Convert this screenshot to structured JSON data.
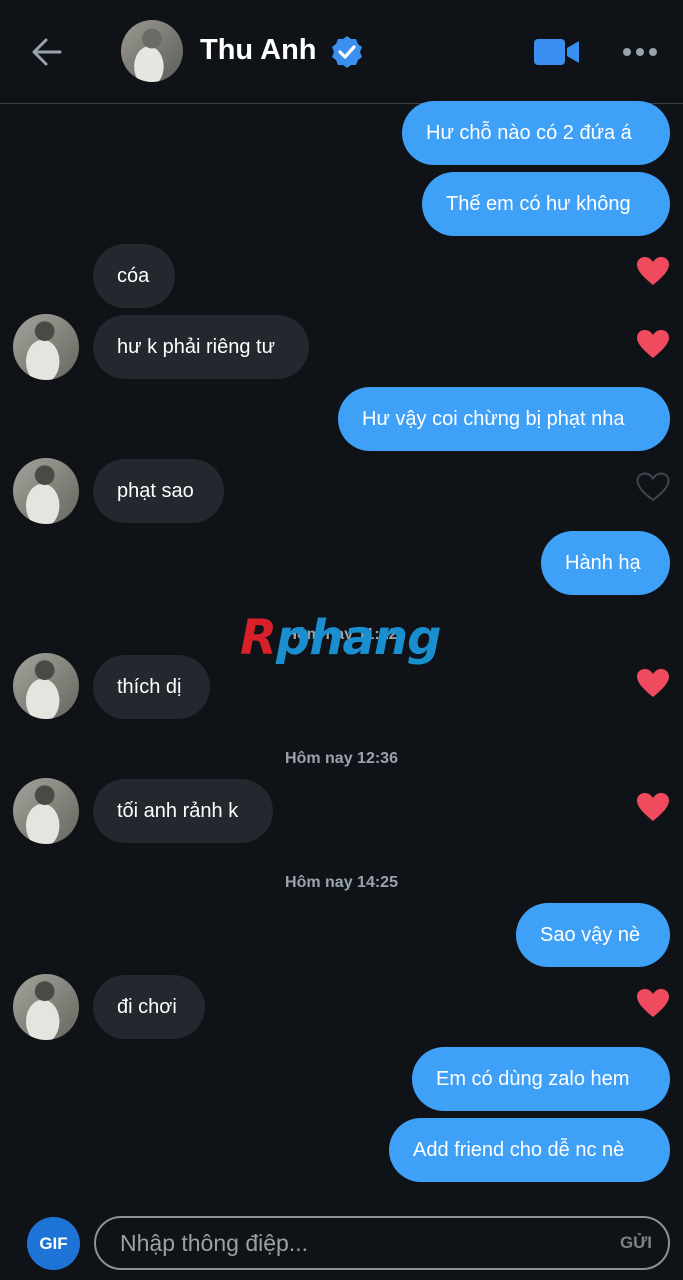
{
  "header": {
    "contact_name": "Thu Anh",
    "verified": true,
    "icons": [
      "back-arrow-icon",
      "verified-badge-icon",
      "video-call-icon",
      "more-options-icon"
    ]
  },
  "colors": {
    "background": "#0f1318",
    "sent_bubble": "#3fa0f7",
    "received_bubble": "#23272e",
    "heart_liked": "#f04a5e",
    "gif_button": "#1d74d6"
  },
  "messages": [
    {
      "sender": "me",
      "text": "Hư chỗ nào có 2 đứa á"
    },
    {
      "sender": "me",
      "text": "Thế em có hư không"
    },
    {
      "sender": "them",
      "text": "cóa",
      "liked": true
    },
    {
      "sender": "them",
      "text": "hư k phải riêng tư",
      "liked": true
    },
    {
      "sender": "me",
      "text": "Hư vậy coi chừng bị phạt nha"
    },
    {
      "sender": "them",
      "text": "phạt sao",
      "liked": false
    },
    {
      "sender": "me",
      "text": "Hành hạ"
    },
    {
      "sender": "them",
      "text": "thích dị",
      "liked": true
    },
    {
      "sender": "them",
      "text": "tối anh rảnh k",
      "liked": true
    },
    {
      "sender": "me",
      "text": "Sao vậy nè"
    },
    {
      "sender": "them",
      "text": "đi chơi",
      "liked": true
    },
    {
      "sender": "me",
      "text": "Em có dùng zalo hem"
    },
    {
      "sender": "me",
      "text": "Add friend cho dễ nc nè"
    }
  ],
  "timestamps": [
    "Hôm nay 11:22",
    "Hôm nay 12:36",
    "Hôm nay 14:25"
  ],
  "watermark": {
    "first": "R",
    "rest": "phang"
  },
  "composer": {
    "gif_label": "GIF",
    "placeholder": "Nhập thông điệp...",
    "send_label": "GỬI"
  }
}
